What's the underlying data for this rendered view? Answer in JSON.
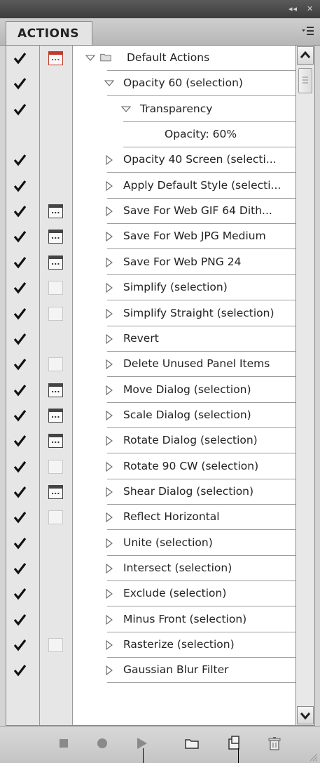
{
  "titlebar": {
    "collapse_glyph": "◂◂",
    "close_glyph": "✕"
  },
  "panel": {
    "tab_label": "ACTIONS"
  },
  "icons": {
    "panel_menu": "panel-menu-icon",
    "check": "checkmark-icon",
    "dialog": "modal-dialog-icon",
    "expand": "disclosure-triangle-icon",
    "folder": "folder-icon",
    "stop": "stop-icon",
    "record": "record-icon",
    "play": "play-icon",
    "new_set": "new-set-folder-icon",
    "new_action": "new-action-icon",
    "trash": "trash-icon"
  },
  "colors": {
    "check": "#111111",
    "dialog_active": "#c0392b",
    "titlebar": "#444444",
    "list_bg": "#ffffff"
  },
  "rows": [
    {
      "label": "Default Actions",
      "check": true,
      "dialog": "red",
      "expanded": true,
      "folder": true,
      "level": 0
    },
    {
      "label": "Opacity 60 (selection)",
      "check": true,
      "dialog": "none",
      "expanded": true,
      "level": 1
    },
    {
      "label": "Transparency",
      "check": true,
      "dialog": "none",
      "expanded": true,
      "level": 2
    },
    {
      "label": "Opacity: 60%",
      "check": false,
      "dialog": "none",
      "level": 3
    },
    {
      "label": "Opacity 40 Screen (selecti...",
      "check": true,
      "dialog": "none",
      "expanded": false,
      "level": 1
    },
    {
      "label": "Apply Default Style (selecti...",
      "check": true,
      "dialog": "none",
      "expanded": false,
      "level": 1
    },
    {
      "label": "Save For Web GIF 64 Dith...",
      "check": true,
      "dialog": "full",
      "expanded": false,
      "level": 1
    },
    {
      "label": "Save For Web JPG Medium",
      "check": true,
      "dialog": "full",
      "expanded": false,
      "level": 1
    },
    {
      "label": "Save For Web PNG 24",
      "check": true,
      "dialog": "full",
      "expanded": false,
      "level": 1
    },
    {
      "label": "Simplify (selection)",
      "check": true,
      "dialog": "empty",
      "expanded": false,
      "level": 1
    },
    {
      "label": "Simplify Straight (selection)",
      "check": true,
      "dialog": "empty",
      "expanded": false,
      "level": 1
    },
    {
      "label": "Revert",
      "check": true,
      "dialog": "none",
      "expanded": false,
      "level": 1
    },
    {
      "label": "Delete Unused Panel Items",
      "check": true,
      "dialog": "empty",
      "expanded": false,
      "level": 1
    },
    {
      "label": "Move Dialog (selection)",
      "check": true,
      "dialog": "full",
      "expanded": false,
      "level": 1
    },
    {
      "label": "Scale Dialog (selection)",
      "check": true,
      "dialog": "full",
      "expanded": false,
      "level": 1
    },
    {
      "label": "Rotate Dialog (selection)",
      "check": true,
      "dialog": "full",
      "expanded": false,
      "level": 1
    },
    {
      "label": "Rotate 90 CW (selection)",
      "check": true,
      "dialog": "empty",
      "expanded": false,
      "level": 1
    },
    {
      "label": "Shear Dialog (selection)",
      "check": true,
      "dialog": "full",
      "expanded": false,
      "level": 1
    },
    {
      "label": "Reflect Horizontal",
      "check": true,
      "dialog": "empty",
      "expanded": false,
      "level": 1
    },
    {
      "label": "Unite (selection)",
      "check": true,
      "dialog": "none",
      "expanded": false,
      "level": 1
    },
    {
      "label": "Intersect (selection)",
      "check": true,
      "dialog": "none",
      "expanded": false,
      "level": 1
    },
    {
      "label": "Exclude (selection)",
      "check": true,
      "dialog": "none",
      "expanded": false,
      "level": 1
    },
    {
      "label": "Minus Front (selection)",
      "check": true,
      "dialog": "none",
      "expanded": false,
      "level": 1
    },
    {
      "label": "Rasterize (selection)",
      "check": true,
      "dialog": "empty",
      "expanded": false,
      "level": 1
    },
    {
      "label": "Gaussian Blur Filter",
      "check": true,
      "dialog": "none",
      "expanded": false,
      "level": 1
    }
  ],
  "toolbar": {
    "buttons": [
      "stop",
      "record",
      "play",
      "new_set",
      "new_action",
      "trash"
    ]
  }
}
